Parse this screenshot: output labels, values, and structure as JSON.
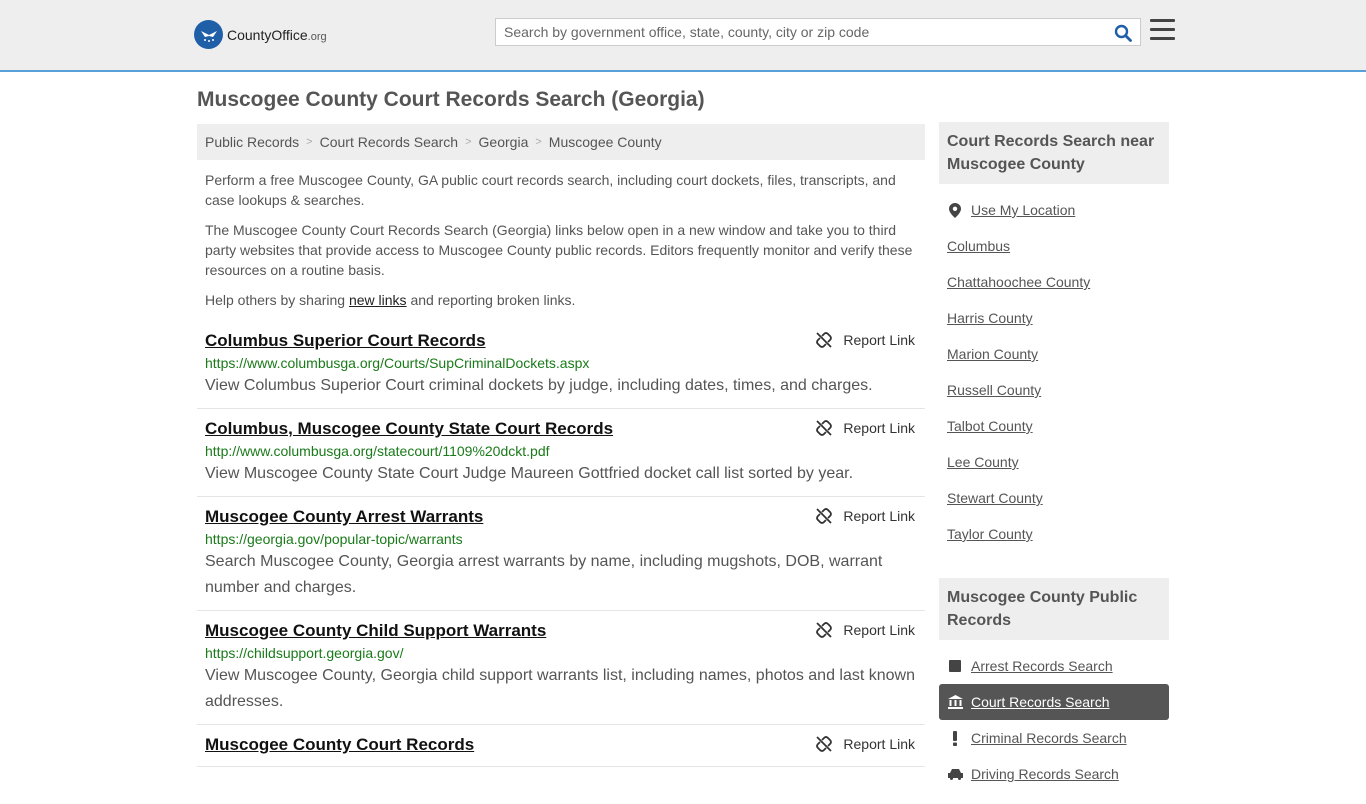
{
  "header": {
    "logo_main": "CountyOffice",
    "logo_suffix": ".org",
    "search_placeholder": "Search by government office, state, county, city or zip code"
  },
  "page_title": "Muscogee County Court Records Search (Georgia)",
  "breadcrumb": [
    "Public Records",
    "Court Records Search",
    "Georgia",
    "Muscogee County"
  ],
  "intro": {
    "p1": "Perform a free Muscogee County, GA public court records search, including court dockets, files, transcripts, and case lookups & searches.",
    "p2": "The Muscogee County Court Records Search (Georgia) links below open in a new window and take you to third party websites that provide access to Muscogee County public records. Editors frequently monitor and verify these resources on a routine basis.",
    "p3_before": "Help others by sharing ",
    "p3_link": "new links",
    "p3_after": " and reporting broken links."
  },
  "report_label": "Report Link",
  "results": [
    {
      "title": "Columbus Superior Court Records",
      "url": "https://www.columbusga.org/Courts/SupCriminalDockets.aspx",
      "desc": "View Columbus Superior Court criminal dockets by judge, including dates, times, and charges."
    },
    {
      "title": "Columbus, Muscogee County State Court Records",
      "url": "http://www.columbusga.org/statecourt/1109%20dckt.pdf",
      "desc": "View Muscogee County State Court Judge Maureen Gottfried docket call list sorted by year."
    },
    {
      "title": "Muscogee County Arrest Warrants",
      "url": "https://georgia.gov/popular-topic/warrants",
      "desc": "Search Muscogee County, Georgia arrest warrants by name, including mugshots, DOB, warrant number and charges."
    },
    {
      "title": "Muscogee County Child Support Warrants",
      "url": "https://childsupport.georgia.gov/",
      "desc": "View Muscogee County, Georgia child support warrants list, including names, photos and last known addresses."
    },
    {
      "title": "Muscogee County Court Records",
      "url": "",
      "desc": ""
    }
  ],
  "sidebar": {
    "near_title": "Court Records Search near Muscogee County",
    "use_location": "Use My Location",
    "near_items": [
      "Columbus",
      "Chattahoochee County",
      "Harris County",
      "Marion County",
      "Russell County",
      "Talbot County",
      "Lee County",
      "Stewart County",
      "Taylor County"
    ],
    "records_title": "Muscogee County Public Records",
    "records_items": [
      {
        "label": "Arrest Records Search",
        "icon": "square-icon"
      },
      {
        "label": "Court Records Search",
        "icon": "courthouse-icon",
        "active": true
      },
      {
        "label": "Criminal Records Search",
        "icon": "exclamation-icon"
      },
      {
        "label": "Driving Records Search",
        "icon": "car-icon"
      }
    ]
  },
  "colors": {
    "header_bg": "#eeeeee",
    "header_border": "#5aa0d8",
    "logo_blue": "#1f5fa8",
    "url_green": "#1a7a1a",
    "active_bg": "#555555"
  }
}
